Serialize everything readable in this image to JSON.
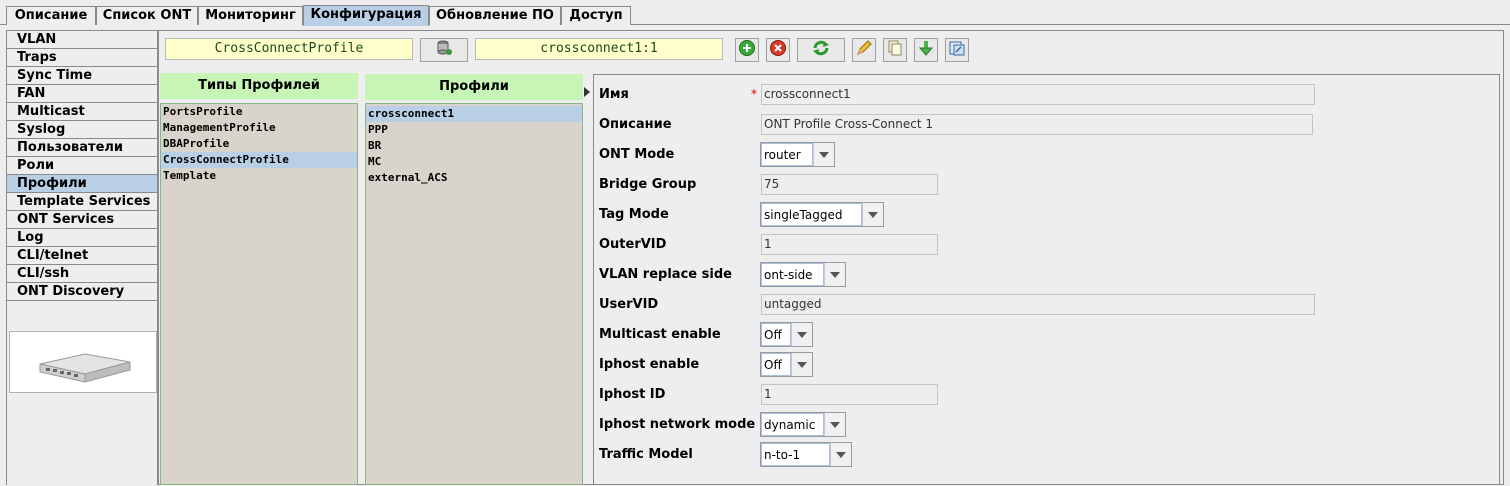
{
  "tabs": [
    "Описание",
    "Список ONT",
    "Мониторинг",
    "Конфигурация",
    "Обновление ПО",
    "Доступ"
  ],
  "active_tab": "Конфигурация",
  "sidebar": {
    "items": [
      "VLAN",
      "Traps",
      "Sync Time",
      "FAN",
      "Multicast",
      "Syslog",
      "Пользователи",
      "Роли",
      "Профили",
      "Template Services",
      "ONT Services",
      "Log",
      "CLI/telnet",
      "CLI/ssh",
      "ONT Discovery"
    ],
    "selected": "Профили"
  },
  "toolbar": {
    "profile_type": "CrossConnectProfile",
    "profile_name": "crossconnect1:1",
    "buttons": [
      "db-icon",
      "add-icon",
      "delete-icon",
      "refresh-icon",
      "edit-icon",
      "copy-icon",
      "download-icon",
      "export-icon"
    ]
  },
  "types_panel": {
    "header": "Типы Профилей",
    "items": [
      "PortsProfile",
      "ManagementProfile",
      "DBAProfile",
      "CrossConnectProfile",
      "Template"
    ],
    "selected": "CrossConnectProfile"
  },
  "profiles_panel": {
    "header": "Профили",
    "items": [
      "crossconnect1",
      "PPP",
      "BR",
      "MC",
      "external_ACS"
    ],
    "selected": "crossconnect1"
  },
  "form": {
    "name": {
      "label": "Имя",
      "value": "crossconnect1",
      "required": "*"
    },
    "description": {
      "label": "Описание",
      "value": "ONT Profile Cross-Connect 1"
    },
    "ont_mode": {
      "label": "ONT Mode",
      "value": "router"
    },
    "bridge_group": {
      "label": "Bridge Group",
      "value": "75"
    },
    "tag_mode": {
      "label": "Tag Mode",
      "value": "singleTagged"
    },
    "outer_vid": {
      "label": "OuterVID",
      "value": "1"
    },
    "vlan_replace_side": {
      "label": "VLAN replace side",
      "value": "ont-side"
    },
    "user_vid": {
      "label": "UserVID",
      "value": "untagged"
    },
    "multicast_enable": {
      "label": "Multicast enable",
      "value": "Off"
    },
    "iphost_enable": {
      "label": "Iphost enable",
      "value": "Off"
    },
    "iphost_id": {
      "label": "Iphost ID",
      "value": "1"
    },
    "iphost_network_mode": {
      "label": "Iphost network mode",
      "value": "dynamic"
    },
    "traffic_model": {
      "label": "Traffic Model",
      "value": "n-to-1"
    }
  },
  "colors": {
    "selection": "#b8cfe5",
    "panel_header": "#c6f5b5",
    "yellow_field": "#ffffcc"
  }
}
